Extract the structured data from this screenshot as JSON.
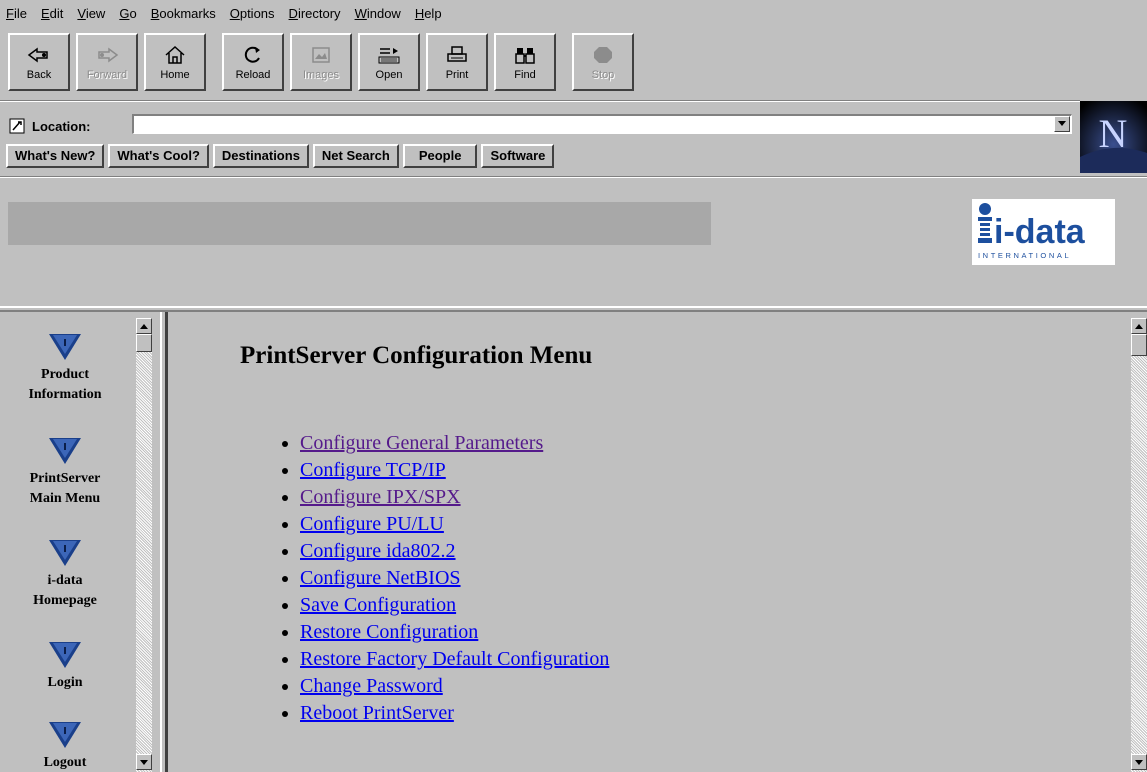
{
  "menu": [
    "File",
    "Edit",
    "View",
    "Go",
    "Bookmarks",
    "Options",
    "Directory",
    "Window",
    "Help"
  ],
  "toolbar": [
    {
      "label": "Back",
      "icon": "back-arrow-icon",
      "enabled": true
    },
    {
      "label": "Forward",
      "icon": "forward-arrow-icon",
      "enabled": false
    },
    {
      "label": "Home",
      "icon": "home-icon",
      "enabled": true
    },
    {
      "label": "Reload",
      "icon": "reload-icon",
      "enabled": true
    },
    {
      "label": "Images",
      "icon": "images-icon",
      "enabled": false
    },
    {
      "label": "Open",
      "icon": "open-icon",
      "enabled": true
    },
    {
      "label": "Print",
      "icon": "printer-icon",
      "enabled": true
    },
    {
      "label": "Find",
      "icon": "find-binoculars-icon",
      "enabled": true
    },
    {
      "label": "Stop",
      "icon": "stop-icon",
      "enabled": false
    }
  ],
  "location": {
    "label": "Location:",
    "value": ""
  },
  "directory_buttons": [
    "What's New?",
    "What's Cool?",
    "Destinations",
    "Net Search",
    "People",
    "Software"
  ],
  "netscape_logo_letter": "N",
  "banner": {
    "logo_main": "i-data",
    "logo_sub": "INTERNATIONAL"
  },
  "nav": [
    {
      "label_lines": [
        "Product",
        "Information"
      ]
    },
    {
      "label_lines": [
        "PrintServer",
        "Main Menu"
      ]
    },
    {
      "label_lines": [
        "i-data",
        "Homepage"
      ]
    },
    {
      "label_lines": [
        "Login"
      ]
    },
    {
      "label_lines": [
        "Logout"
      ]
    }
  ],
  "main": {
    "title": "PrintServer Configuration Menu",
    "links": [
      {
        "text": "Configure General Parameters",
        "visited": true
      },
      {
        "text": "Configure TCP/IP",
        "visited": false
      },
      {
        "text": "Configure IPX/SPX",
        "visited": true
      },
      {
        "text": "Configure PU/LU",
        "visited": false
      },
      {
        "text": "Configure ida802.2",
        "visited": false
      },
      {
        "text": "Configure NetBIOS",
        "visited": false
      },
      {
        "text": "Save Configuration",
        "visited": false
      },
      {
        "text": "Restore Configuration",
        "visited": false
      },
      {
        "text": "Restore Factory Default Configuration",
        "visited": false
      },
      {
        "text": "Change Password",
        "visited": false
      },
      {
        "text": "Reboot PrintServer",
        "visited": false
      }
    ]
  },
  "colors": {
    "chrome": "#c0c0c0",
    "link": "#0000ee",
    "visited_link": "#551a8b",
    "nav_icon": "#1a3f8a",
    "logo_blue": "#1d4f9e"
  }
}
